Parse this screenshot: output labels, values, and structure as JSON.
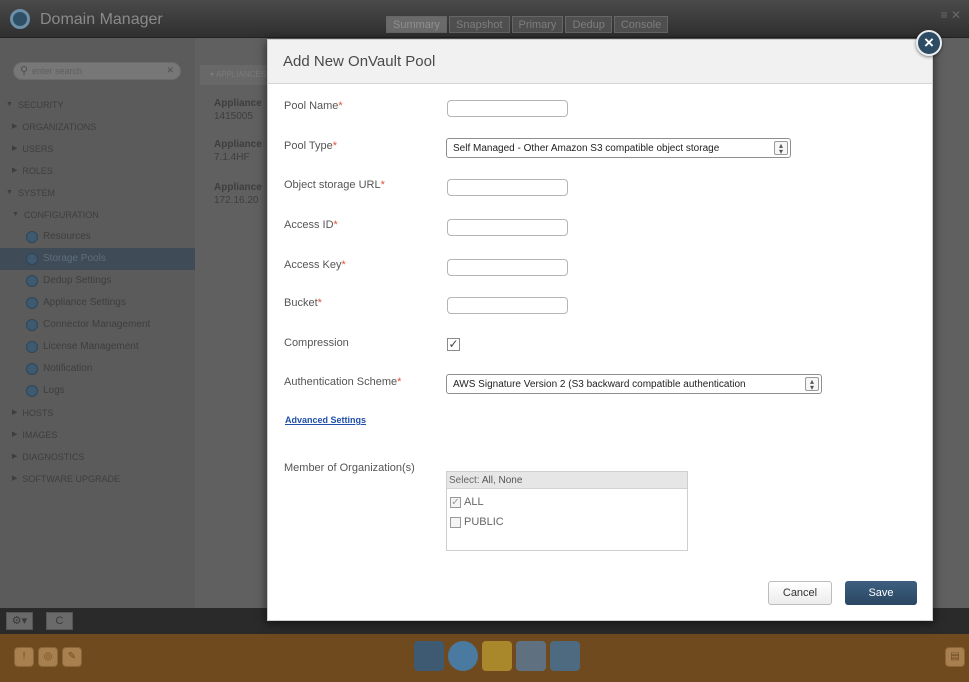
{
  "app": {
    "title": "Domain Manager",
    "top_tabs": [
      "Summary",
      "Snapshot",
      "Primary",
      "Dedup",
      "Console"
    ],
    "search_placeholder": "enter search",
    "panel_header": "APPLIANCES",
    "appliances": [
      {
        "name": "Appliance",
        "detail": "1415005"
      },
      {
        "name": "Appliance",
        "detail": "7.1.4HF"
      },
      {
        "name": "Appliance",
        "detail": "172.16.20"
      }
    ],
    "nav": [
      {
        "label": "SECURITY",
        "level": 0,
        "expanded": true
      },
      {
        "label": "ORGANIZATIONS",
        "level": 1
      },
      {
        "label": "USERS",
        "level": 1
      },
      {
        "label": "ROLES",
        "level": 1
      },
      {
        "label": "SYSTEM",
        "level": 0,
        "expanded": true
      },
      {
        "label": "CONFIGURATION",
        "level": 1,
        "expanded": true
      },
      {
        "label": "Resources",
        "level": 2
      },
      {
        "label": "Storage Pools",
        "level": 2,
        "active": true
      },
      {
        "label": "Dedup Settings",
        "level": 2
      },
      {
        "label": "Appliance Settings",
        "level": 2
      },
      {
        "label": "Connector Management",
        "level": 2
      },
      {
        "label": "License Management",
        "level": 2
      },
      {
        "label": "Notification",
        "level": 2
      },
      {
        "label": "Logs",
        "level": 2
      },
      {
        "label": "HOSTS",
        "level": 1
      },
      {
        "label": "IMAGES",
        "level": 1
      },
      {
        "label": "DIAGNOSTICS",
        "level": 1
      },
      {
        "label": "SOFTWARE UPGRADE",
        "level": 1
      }
    ]
  },
  "modal": {
    "title": "Add New OnVault Pool",
    "fields": {
      "pool_name": {
        "label": "Pool Name",
        "value": ""
      },
      "pool_type": {
        "label": "Pool Type",
        "value": "Self Managed - Other Amazon S3 compatible object storage"
      },
      "object_url": {
        "label": "Object storage URL",
        "value": ""
      },
      "access_id": {
        "label": "Access ID",
        "value": ""
      },
      "access_key": {
        "label": "Access Key",
        "value": ""
      },
      "bucket": {
        "label": "Bucket",
        "value": ""
      },
      "compression": {
        "label": "Compression",
        "checked": true
      },
      "auth_scheme": {
        "label": "Authentication Scheme",
        "value": "AWS Signature Version 2 (S3 backward compatible authentication"
      }
    },
    "required_mark": "*",
    "advanced_link": "Advanced Settings",
    "org": {
      "label": "Member of Organization(s)",
      "select_prefix": "Select:",
      "select_all": "All",
      "select_none": "None",
      "options": [
        {
          "label": "ALL",
          "checked": true
        },
        {
          "label": "PUBLIC",
          "checked": false
        }
      ]
    },
    "cancel_label": "Cancel",
    "save_label": "Save",
    "close_glyph": "×"
  },
  "colors": {
    "save_bg": "#2f4f6e",
    "close_bg": "#2d4b63",
    "link": "#1f4fa8",
    "required": "#e0523b",
    "dock": "#6f4a1f"
  }
}
